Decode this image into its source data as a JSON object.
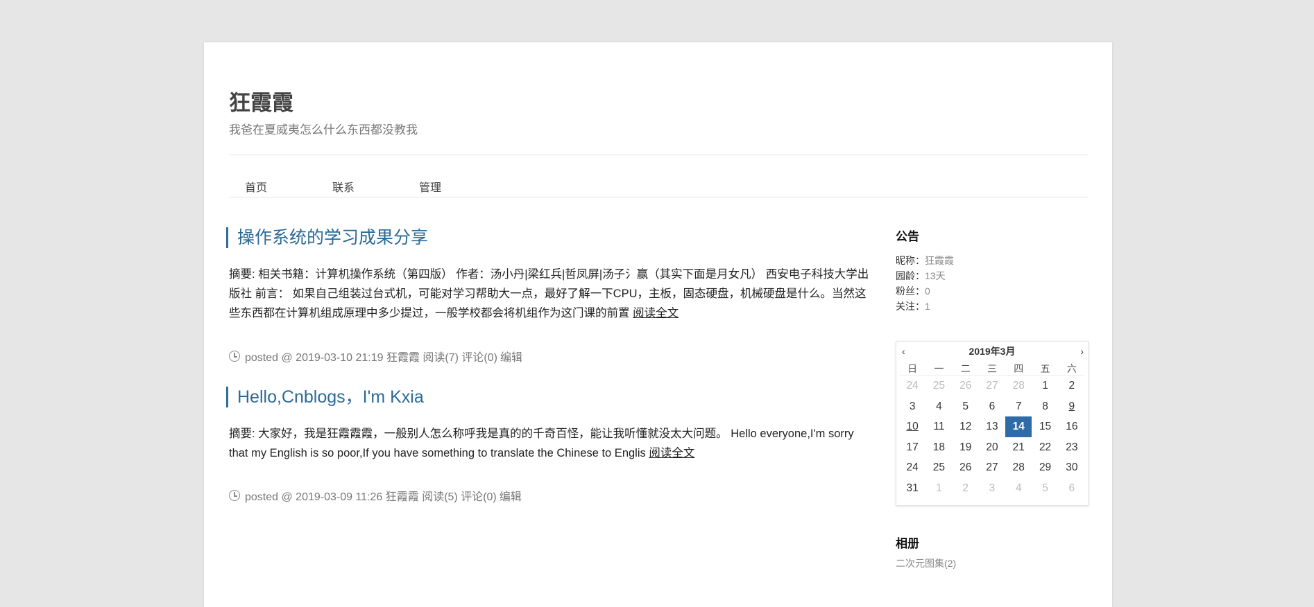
{
  "header": {
    "title": "狂霞霞",
    "subtitle": "我爸在夏威夷怎么什么东西都没教我"
  },
  "nav": {
    "items": [
      "首页",
      "联系",
      "管理"
    ]
  },
  "posts": [
    {
      "title": "操作系统的学习成果分享",
      "summary": "摘要: 相关书籍：计算机操作系统（第四版） 作者：汤小丹|梁红兵|哲凤屏|汤子氵赢（其实下面是月女凡） 西安电子科技大学出版社 前言： 如果自己组装过台式机，可能对学习帮助大一点，最好了解一下CPU，主板，固态硬盘，机械硬盘是什么。当然这些东西都在计算机组成原理中多少提过，一般学校都会将机组作为这门课的前置",
      "read_more": "阅读全文",
      "meta": {
        "posted": "posted @ 2019-03-10 21:19 狂霞霞 阅读(7) 评论(0)",
        "edit": "编辑"
      }
    },
    {
      "title": "Hello,Cnblogs，I'm Kxia",
      "summary": "摘要: 大家好，我是狂霞霞霞，一般别人怎么称呼我是真的的千奇百怪，能让我听懂就没太大问题。 Hello everyone,I'm sorry that my English is so poor,If you have something to translate the Chinese to Englis",
      "read_more": "阅读全文",
      "meta": {
        "posted": "posted @ 2019-03-09 11:26 狂霞霞 阅读(5) 评论(0)",
        "edit": "编辑"
      }
    }
  ],
  "sidebar": {
    "notice_heading": "公告",
    "profile": [
      {
        "label": "昵称：",
        "value": "狂霞霞"
      },
      {
        "label": "园龄：",
        "value": "13天"
      },
      {
        "label": "粉丝：",
        "value": "0"
      },
      {
        "label": "关注：",
        "value": "1"
      }
    ],
    "calendar": {
      "prev": "‹",
      "next": "›",
      "month": "2019年3月",
      "weekdays": [
        "日",
        "一",
        "二",
        "三",
        "四",
        "五",
        "六"
      ],
      "days": [
        {
          "d": "24",
          "other": true
        },
        {
          "d": "25",
          "other": true
        },
        {
          "d": "26",
          "other": true
        },
        {
          "d": "27",
          "other": true
        },
        {
          "d": "28",
          "other": true
        },
        {
          "d": "1"
        },
        {
          "d": "2"
        },
        {
          "d": "3"
        },
        {
          "d": "4"
        },
        {
          "d": "5"
        },
        {
          "d": "6"
        },
        {
          "d": "7"
        },
        {
          "d": "8"
        },
        {
          "d": "9",
          "link": true
        },
        {
          "d": "10",
          "link": true
        },
        {
          "d": "11"
        },
        {
          "d": "12"
        },
        {
          "d": "13"
        },
        {
          "d": "14",
          "today": true
        },
        {
          "d": "15"
        },
        {
          "d": "16"
        },
        {
          "d": "17"
        },
        {
          "d": "18"
        },
        {
          "d": "19"
        },
        {
          "d": "20"
        },
        {
          "d": "21"
        },
        {
          "d": "22"
        },
        {
          "d": "23"
        },
        {
          "d": "24"
        },
        {
          "d": "25"
        },
        {
          "d": "26"
        },
        {
          "d": "27"
        },
        {
          "d": "28"
        },
        {
          "d": "29"
        },
        {
          "d": "30"
        },
        {
          "d": "31"
        },
        {
          "d": "1",
          "other": true
        },
        {
          "d": "2",
          "other": true
        },
        {
          "d": "3",
          "other": true
        },
        {
          "d": "4",
          "other": true
        },
        {
          "d": "5",
          "other": true
        },
        {
          "d": "6",
          "other": true
        }
      ]
    },
    "album_heading": "相册",
    "album_link": "二次元图集(2)"
  },
  "colors": {
    "accent": "#2a6b98",
    "today": "#2e6ba7",
    "background": "#e6e6e6"
  }
}
